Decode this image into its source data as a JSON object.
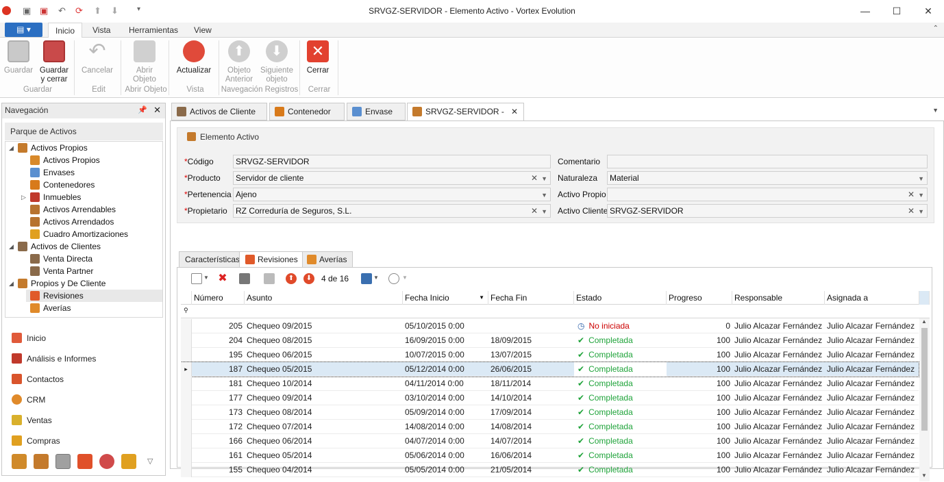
{
  "window": {
    "title": "SRVGZ-SERVIDOR - Elemento Activo - Vortex Evolution",
    "minimize_glyph": "—",
    "maximize_glyph": "☐",
    "close_glyph": "✕"
  },
  "menu": {
    "tabs": [
      {
        "label": "Inicio",
        "active": true
      },
      {
        "label": "Vista"
      },
      {
        "label": "Herramientas"
      },
      {
        "label": "View"
      }
    ]
  },
  "ribbon": {
    "buttons": [
      {
        "label": "Guardar",
        "label2": "",
        "enabled": false
      },
      {
        "label": "Guardar",
        "label2": "y cerrar",
        "enabled": true
      },
      {
        "label": "Cancelar",
        "label2": "",
        "enabled": false
      },
      {
        "label": "Abrir",
        "label2": "Objeto",
        "enabled": false
      },
      {
        "label": "Actualizar",
        "label2": "",
        "enabled": true
      },
      {
        "label": "Objeto",
        "label2": "Anterior",
        "enabled": false
      },
      {
        "label": "Siguiente",
        "label2": "objeto",
        "enabled": false
      },
      {
        "label": "Cerrar",
        "label2": "",
        "enabled": true
      }
    ],
    "groups": [
      "Guardar",
      "Edit",
      "Abrir Objeto",
      "Vista",
      "Navegación Registros",
      "Cerrar"
    ]
  },
  "nav": {
    "title": "Navegación",
    "section": "Parque de Activos",
    "tree": [
      {
        "label": "Activos Propios",
        "level": 0
      },
      {
        "label": "Activos Propios",
        "level": 1
      },
      {
        "label": "Envases",
        "level": 1
      },
      {
        "label": "Contenedores",
        "level": 1
      },
      {
        "label": "Inmuebles",
        "level": 1
      },
      {
        "label": "Activos Arrendables",
        "level": 1
      },
      {
        "label": "Activos Arrendados",
        "level": 1
      },
      {
        "label": "Cuadro Amortizaciones",
        "level": 1
      },
      {
        "label": "Activos de Clientes",
        "level": 0
      },
      {
        "label": "Venta Directa",
        "level": 1
      },
      {
        "label": "Venta Partner",
        "level": 1
      },
      {
        "label": "Propios y De Cliente",
        "level": 0
      },
      {
        "label": "Revisiones",
        "level": 1,
        "selected": true
      },
      {
        "label": "Averías",
        "level": 1
      }
    ],
    "links": [
      "Inicio",
      "Análisis e Informes",
      "Contactos",
      "CRM",
      "Ventas",
      "Compras"
    ]
  },
  "doc_tabs": [
    {
      "label": "Activos de Cliente"
    },
    {
      "label": "Contenedor"
    },
    {
      "label": "Envase"
    },
    {
      "label": "SRVGZ-SERVIDOR - Elem",
      "active": true,
      "close": "✕"
    }
  ],
  "form": {
    "title": "Elemento Activo",
    "required_mark": "*",
    "fields": {
      "codigo": {
        "label": "Código",
        "value": "SRVGZ-SERVIDOR"
      },
      "producto": {
        "label": "Producto",
        "value": "Servidor de cliente"
      },
      "pertenencia": {
        "label": "Pertenencia",
        "value": "Ajeno"
      },
      "propietario": {
        "label": "Propietario",
        "value": "RZ Correduría de Seguros, S.L."
      },
      "comentario": {
        "label": "Comentario",
        "value": ""
      },
      "naturaleza": {
        "label": "Naturaleza",
        "value": "Material"
      },
      "activo_propio": {
        "label": "Activo Propio",
        "value": ""
      },
      "activo_cliente": {
        "label": "Activo Cliente",
        "value": "SRVGZ-SERVIDOR"
      }
    }
  },
  "inner_tabs": [
    {
      "label": "Características"
    },
    {
      "label": "Revisiones",
      "active": true
    },
    {
      "label": "Averías"
    }
  ],
  "grid_toolbar": {
    "record_counter": "4 de 16"
  },
  "grid": {
    "columns": [
      "Número",
      "Asunto",
      "Fecha Inicio",
      "Fecha Fin",
      "Estado",
      "Progreso",
      "Responsable",
      "Asignada a"
    ],
    "rows": [
      {
        "num": "205",
        "asunto": "Chequeo 09/2015",
        "inicio": "05/10/2015 0:00",
        "fin": "",
        "estado": "No iniciada",
        "progreso": "0",
        "responsable": "Julio Alcazar Fernández",
        "asignada": "Julio Alcazar Fernández"
      },
      {
        "num": "204",
        "asunto": "Chequeo 08/2015",
        "inicio": "16/09/2015 0:00",
        "fin": "18/09/2015",
        "estado": "Completada",
        "progreso": "100",
        "responsable": "Julio Alcazar Fernández",
        "asignada": "Julio Alcazar Fernández"
      },
      {
        "num": "195",
        "asunto": "Chequeo 06/2015",
        "inicio": "10/07/2015 0:00",
        "fin": "13/07/2015",
        "estado": "Completada",
        "progreso": "100",
        "responsable": "Julio Alcazar Fernández",
        "asignada": "Julio Alcazar Fernández"
      },
      {
        "num": "187",
        "asunto": "Chequeo 05/2015",
        "inicio": "05/12/2014 0:00",
        "fin": "26/06/2015",
        "estado": "Completada",
        "progreso": "100",
        "responsable": "Julio Alcazar Fernández",
        "asignada": "Julio Alcazar Fernández",
        "selected": true
      },
      {
        "num": "181",
        "asunto": "Chequeo 10/2014",
        "inicio": "04/11/2014 0:00",
        "fin": "18/11/2014",
        "estado": "Completada",
        "progreso": "100",
        "responsable": "Julio Alcazar Fernández",
        "asignada": "Julio Alcazar Fernández"
      },
      {
        "num": "177",
        "asunto": "Chequeo 09/2014",
        "inicio": "03/10/2014 0:00",
        "fin": "14/10/2014",
        "estado": "Completada",
        "progreso": "100",
        "responsable": "Julio Alcazar Fernández",
        "asignada": "Julio Alcazar Fernández"
      },
      {
        "num": "173",
        "asunto": "Chequeo 08/2014",
        "inicio": "05/09/2014 0:00",
        "fin": "17/09/2014",
        "estado": "Completada",
        "progreso": "100",
        "responsable": "Julio Alcazar Fernández",
        "asignada": "Julio Alcazar Fernández"
      },
      {
        "num": "172",
        "asunto": "Chequeo 07/2014",
        "inicio": "14/08/2014 0:00",
        "fin": "14/08/2014",
        "estado": "Completada",
        "progreso": "100",
        "responsable": "Julio Alcazar Fernández",
        "asignada": "Julio Alcazar Fernández"
      },
      {
        "num": "166",
        "asunto": "Chequeo 06/2014",
        "inicio": "04/07/2014 0:00",
        "fin": "14/07/2014",
        "estado": "Completada",
        "progreso": "100",
        "responsable": "Julio Alcazar Fernández",
        "asignada": "Julio Alcazar Fernández"
      },
      {
        "num": "161",
        "asunto": "Chequeo 05/2014",
        "inicio": "05/06/2014 0:00",
        "fin": "16/06/2014",
        "estado": "Completada",
        "progreso": "100",
        "responsable": "Julio Alcazar Fernández",
        "asignada": "Julio Alcazar Fernández"
      },
      {
        "num": "155",
        "asunto": "Chequeo 04/2014",
        "inicio": "05/05/2014 0:00",
        "fin": "21/05/2014",
        "estado": "Completada",
        "progreso": "100",
        "responsable": "Julio Alcazar Fernández",
        "asignada": "Julio Alcazar Fernández"
      }
    ]
  },
  "colors": {
    "accent": "#2b6fc2",
    "complete": "#1fa33a",
    "not_started": "#cc0000",
    "selected_row": "#dbe9f5"
  }
}
